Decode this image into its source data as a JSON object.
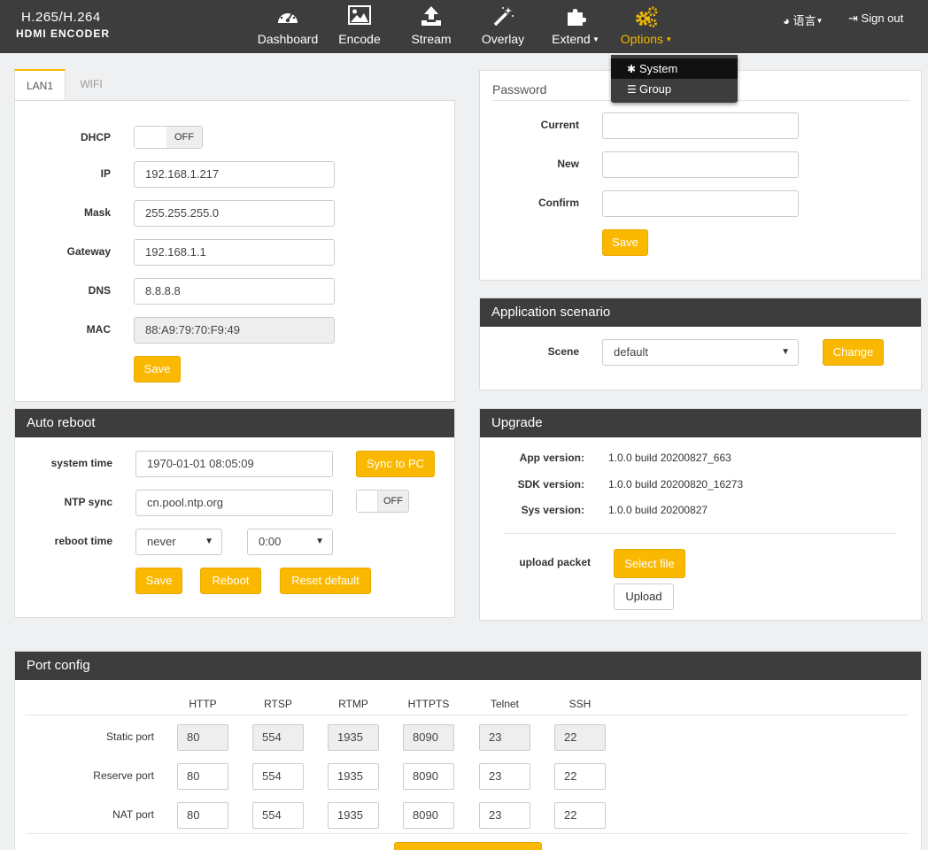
{
  "brand": {
    "line1": "H.265/H.264",
    "line2": "HDMI ENCODER"
  },
  "nav": [
    {
      "label": "Dashboard",
      "icon": "dashboard-icon"
    },
    {
      "label": "Encode",
      "icon": "image-icon"
    },
    {
      "label": "Stream",
      "icon": "upload-icon"
    },
    {
      "label": "Overlay",
      "icon": "magic-wand-icon"
    },
    {
      "label": "Extend",
      "icon": "puzzle-icon"
    },
    {
      "label": "Options",
      "icon": "gears-icon"
    }
  ],
  "topright": {
    "language": "语言",
    "signout": "Sign out"
  },
  "options_menu": {
    "system": "System",
    "group": "Group"
  },
  "colors": {
    "accent": "#fab800",
    "header": "#3d3d3d"
  },
  "lan": {
    "tabs": [
      "LAN1",
      "WIFI"
    ],
    "dhcp_label": "DHCP",
    "dhcp_state": "OFF",
    "ip_label": "IP",
    "ip": "192.168.1.217",
    "mask_label": "Mask",
    "mask": "255.255.255.0",
    "gateway_label": "Gateway",
    "gateway": "192.168.1.1",
    "dns_label": "DNS",
    "dns": "8.8.8.8",
    "mac_label": "MAC",
    "mac": "88:A9:79:70:F9:49",
    "save": "Save"
  },
  "password": {
    "title": "Password",
    "current": "Current",
    "new": "New",
    "confirm": "Confirm",
    "save": "Save"
  },
  "scenario": {
    "title": "Application scenario",
    "scene_label": "Scene",
    "scene_value": "default",
    "change": "Change"
  },
  "reboot": {
    "title": "Auto reboot",
    "system_time_label": "system time",
    "system_time": "1970-01-01 08:05:09",
    "sync": "Sync to PC",
    "ntp_label": "NTP sync",
    "ntp": "cn.pool.ntp.org",
    "ntp_state": "OFF",
    "reboot_time_label": "reboot time",
    "reboot_day": "never",
    "reboot_hour": "0:00",
    "save": "Save",
    "reboot": "Reboot",
    "reset": "Reset default"
  },
  "upgrade": {
    "title": "Upgrade",
    "app_label": "App version:",
    "app": "1.0.0 build 20200827_663",
    "sdk_label": "SDK version:",
    "sdk": "1.0.0 build 20200820_16273",
    "sys_label": "Sys version:",
    "sys": "1.0.0 build 20200827",
    "upload_label": "upload packet",
    "select": "Select file",
    "upload": "Upload"
  },
  "ports": {
    "title": "Port config",
    "columns": [
      "HTTP",
      "RTSP",
      "RTMP",
      "HTTPTS",
      "Telnet",
      "SSH"
    ],
    "rows": [
      {
        "label": "Static port",
        "values": [
          "80",
          "554",
          "1935",
          "8090",
          "23",
          "22"
        ]
      },
      {
        "label": "Reserve port",
        "values": [
          "80",
          "554",
          "1935",
          "8090",
          "23",
          "22"
        ]
      },
      {
        "label": "NAT port",
        "values": [
          "80",
          "554",
          "1935",
          "8090",
          "23",
          "22"
        ]
      }
    ]
  }
}
